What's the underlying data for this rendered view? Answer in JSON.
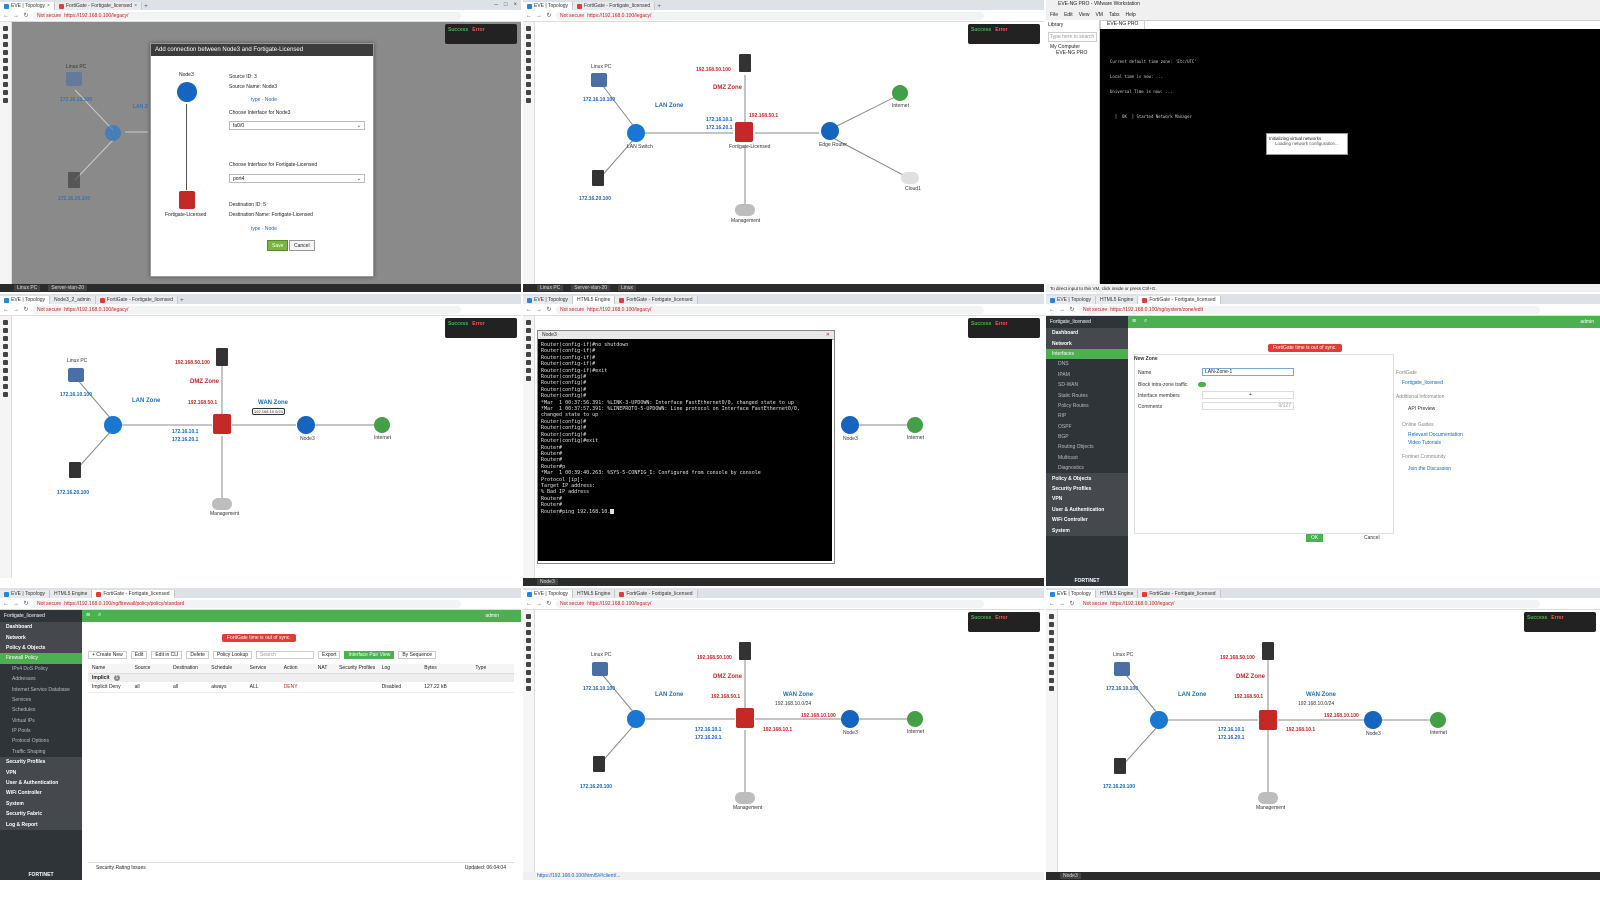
{
  "panels": {
    "p1": {
      "tabs": [
        "EVE | Topology",
        "FortiGate - Fortigate_licensed"
      ],
      "url": "https://192.168.0.100/legacy/",
      "not_secure": "Not secure",
      "status": {
        "success": "Success",
        "error": "Error"
      },
      "dialog": {
        "title": "Add connection between Node3 and Fortigate-Licensed",
        "source_node": "Node3",
        "dest_node": "Fortigate-Licensed",
        "source_id": "Source ID: 3",
        "source_name": "Source Name: Node3",
        "source_type": "type - Node",
        "choose_src": "Choose Interface for Node3",
        "src_value": "fa0/0",
        "choose_dst": "Choose Interface for Fortigate-Licensed",
        "dst_value": "port4",
        "dest_id": "Destination ID: 5",
        "dest_name": "Destination Name: Fortigate-Licensed",
        "dest_type": "type - Node",
        "save": "Save",
        "cancel": "Cancel"
      },
      "labels": {
        "linux": "Linux PC",
        "linux_ip": "172.16.10.100",
        "lan": "LAN Z",
        "server_ip": "172.16.20.100"
      },
      "bottom": [
        "Linux PC",
        "Server-vlan-20"
      ]
    },
    "p2": {
      "tabs": [
        "EVE | Topology",
        "FortiGate - Fortigate_licensed"
      ],
      "url": "https://192.168.0.100/legacy/",
      "not_secure": "Not secure",
      "status": {
        "success": "Success",
        "error": "Error"
      },
      "labels": {
        "linux": "Linux PC",
        "linux_ip": "172.16.10.100",
        "dmz_ip": "192.168.50.100",
        "dmz": "DMZ Zone",
        "dmz_gw": "192.168.50.1",
        "lan": "LAN Zone",
        "fg_ip1": "172.16.10.1",
        "fg_ip2": "172.16.20.1",
        "internet": "Internet",
        "cloud": "Cloud1",
        "edge": "Edge Router",
        "server_ip": "172.16.20.100",
        "mgmt": "Management",
        "lan_switch": "LAN Switch",
        "fortigate": "Fortigate-Licensed"
      },
      "bottom": [
        "Linux PC",
        "Server-vlan-20",
        "Linux"
      ]
    },
    "p3": {
      "title": "EVE-NG PRO - VMware Workstation",
      "menu": [
        "File",
        "Edit",
        "View",
        "VM",
        "Tabs",
        "Help"
      ],
      "library": "Library",
      "search": "Type here to search",
      "tree": [
        "My Computer",
        "EVE-NG PRO"
      ],
      "vm_tab": "EVE-NG PRO",
      "console": [
        "Current default time zone: 'Etc/UTC'",
        "Local time is now: ...",
        "Universal Time is now: ...",
        "",
        "  [  OK  ] Started Network Manager"
      ],
      "dialog_title": "Initializing virtual networks",
      "dialog_text": "Loading network configuration...",
      "statusbar": "To direct input to this VM, click inside or press Ctrl+G."
    },
    "p4": {
      "tabs": [
        "EVE | Topology",
        "Node3_2_admin",
        "FortiGate - Fortigate_licensed"
      ],
      "url": "https://192.168.0.100/legacy/",
      "not_secure": "Not secure",
      "status": {
        "success": "Success",
        "error": "Error"
      },
      "labels": {
        "linux": "Linux PC",
        "linux_ip": "172.16.10.100",
        "dmz_ip": "192.168.50.100",
        "dmz": "DMZ Zone",
        "dmz_gw": "192.168.50.1",
        "lan": "LAN Zone",
        "wan": "WAN Zone",
        "wan_ip": "192.168.10.0/24",
        "fg_ip1": "172.16.10.1",
        "fg_ip2": "172.16.20.1",
        "server_ip": "172.16.20.100",
        "mgmt": "Management",
        "node3": "Node3",
        "internet": "Internet"
      }
    },
    "p5": {
      "tabs": [
        "EVE | Topology",
        "HTML5 Engine",
        "FortiGate - Fortigate_licensed"
      ],
      "url": "https://192.168.0.100/legacy/",
      "not_secure": "Not secure",
      "status": {
        "success": "Success",
        "error": "Error"
      },
      "terminal_title": "Node3",
      "terminal": [
        "Router(config-if)#no shutdown",
        "Router(config-if)#",
        "Router(config-if)#",
        "Router(config-if)#",
        "Router(config-if)#exit",
        "Router(config)#",
        "Router(config)#",
        "Router(config)#",
        "Router(config)#",
        "*Mar  1 00:37:56.391: %LINK-3-UPDOWN: Interface FastEthernet0/0, changed state to up",
        "*Mar  1 00:37:57.391: %LINEPROTO-5-UPDOWN: Line protocol on Interface FastEthernet0/0,",
        "changed state to up",
        "Router(config)#",
        "Router(config)#",
        "Router(config)#",
        "Router(config)#exit",
        "Router#",
        "Router#",
        "Router#",
        "Router#p",
        "*Mar  1 00:39:40.263: %SYS-5-CONFIG_I: Configured from console by console",
        "Protocol [ip]:",
        "Target IP address:",
        "% Bad IP address",
        "Router#",
        "Router#",
        "Router#ping 192.168.10."
      ],
      "node3": "Node3",
      "internet": "Internet",
      "bottom": [
        "Node3"
      ]
    },
    "p6": {
      "tabs": [
        "EVE | Topology",
        "HTML5 Engine",
        "FortiGate - Fortigate_licensed"
      ],
      "url": "https://192.168.0.100/ng/system/zone/edit",
      "not_secure": "Not secure",
      "device": "Fortigate_licensed",
      "alert": "FortiGate time is out of sync.",
      "user": "admin",
      "menu": [
        {
          "label": "Dashboard",
          "kind": "head"
        },
        {
          "label": "Network",
          "kind": "head"
        },
        {
          "label": "Interfaces",
          "kind": "act"
        },
        {
          "label": "DNS",
          "kind": "sub"
        },
        {
          "label": "IPAM",
          "kind": "sub"
        },
        {
          "label": "SD-WAN",
          "kind": "sub"
        },
        {
          "label": "Static Routes",
          "kind": "sub"
        },
        {
          "label": "Policy Routes",
          "kind": "sub"
        },
        {
          "label": "RIP",
          "kind": "sub"
        },
        {
          "label": "OSPF",
          "kind": "sub"
        },
        {
          "label": "BGP",
          "kind": "sub"
        },
        {
          "label": "Routing Objects",
          "kind": "sub"
        },
        {
          "label": "Multicast",
          "kind": "sub"
        },
        {
          "label": "Diagnostics",
          "kind": "sub"
        },
        {
          "label": "Policy & Objects",
          "kind": "head"
        },
        {
          "label": "Security Profiles",
          "kind": "head"
        },
        {
          "label": "VPN",
          "kind": "head"
        },
        {
          "label": "User & Authentication",
          "kind": "head"
        },
        {
          "label": "WiFi Controller",
          "kind": "head"
        },
        {
          "label": "System",
          "kind": "head"
        }
      ],
      "form_title": "New Zone",
      "name_label": "Name",
      "name_value": "LAN-Zone-1",
      "block_label": "Block intra-zone traffic",
      "members_label": "Interface members",
      "comments_label": "Comments",
      "comments_count": "0/127",
      "side_title": "FortiGate",
      "side_device": "Fortigate_licensed",
      "side_info": "Additional Information",
      "side_api": "API Preview",
      "side_online": "Online Guides",
      "side_doc": "Relevant Documentation",
      "side_video": "Video Tutorials",
      "side_community": "Fortinet Community",
      "side_join": "Join the Discussion",
      "ok": "OK",
      "cancel": "Cancel",
      "brand": "FORTINET"
    },
    "p7": {
      "tabs": [
        "EVE | Topology",
        "HTML5 Engine",
        "FortiGate - Fortigate_licensed"
      ],
      "url": "https://192.168.0.100/ng/firewall/policy/policy/standard",
      "not_secure": "Not secure",
      "device": "Fortigate_licensed",
      "alert": "FortiGate time is out of sync.",
      "user": "admin",
      "menu": [
        {
          "label": "Dashboard",
          "kind": "head"
        },
        {
          "label": "Network",
          "kind": "head"
        },
        {
          "label": "Policy & Objects",
          "kind": "head"
        },
        {
          "label": "Firewall Policy",
          "kind": "act"
        },
        {
          "label": "IPv4 DoS Policy",
          "kind": "sub"
        },
        {
          "label": "Addresses",
          "kind": "sub"
        },
        {
          "label": "Internet Service Database",
          "kind": "sub"
        },
        {
          "label": "Services",
          "kind": "sub"
        },
        {
          "label": "Schedules",
          "kind": "sub"
        },
        {
          "label": "Virtual IPs",
          "kind": "sub"
        },
        {
          "label": "IP Pools",
          "kind": "sub"
        },
        {
          "label": "Protocol Options",
          "kind": "sub"
        },
        {
          "label": "Traffic Shaping",
          "kind": "sub"
        },
        {
          "label": "Security Profiles",
          "kind": "head"
        },
        {
          "label": "VPN",
          "kind": "head"
        },
        {
          "label": "User & Authentication",
          "kind": "head"
        },
        {
          "label": "WiFi Controller",
          "kind": "head"
        },
        {
          "label": "System",
          "kind": "head"
        },
        {
          "label": "Security Fabric",
          "kind": "head"
        },
        {
          "label": "Log & Report",
          "kind": "head"
        }
      ],
      "toolbar": [
        "+ Create New",
        "Edit",
        "Edit in CLI",
        "Delete",
        "Policy Lookup",
        "Search",
        "Export",
        "Interface Pair View",
        "By Sequence"
      ],
      "columns": [
        "Name",
        "Source",
        "Destination",
        "Schedule",
        "Service",
        "Action",
        "NAT",
        "Security Profiles",
        "Log",
        "Bytes",
        "Type"
      ],
      "group": "Implicit",
      "group_count": "1",
      "row": [
        "Implicit Deny",
        "all",
        "all",
        "always",
        "ALL",
        "DENY",
        "",
        "",
        "Disabled",
        "127.22 kB",
        ""
      ],
      "footer_left": "Security Rating Issues",
      "footer_right": "Updated: 06:04:04",
      "brand": "FORTINET"
    },
    "p8": {
      "tabs": [
        "EVE | Topology",
        "HTML5 Engine",
        "FortiGate - Fortigate_licensed"
      ],
      "url": "https://192.168.0.100/legacy/",
      "not_secure": "Not secure",
      "status": {
        "success": "Success",
        "error": "Error"
      },
      "labels": {
        "linux": "Linux PC",
        "linux_ip": "172.16.10.100",
        "dmz_ip": "192.168.50.100",
        "dmz": "DMZ Zone",
        "dmz_gw": "192.168.50.1",
        "lan": "LAN Zone",
        "wan": "WAN Zone",
        "wan_net": "192.168.10.0/24",
        "wan_fg": "192.168.10.1",
        "wan_r": "192.168.10.100",
        "fg_ip1": "172.16.10.1",
        "fg_ip2": "172.16.20.1",
        "server_ip": "172.16.20.100",
        "mgmt": "Management",
        "node3": "Node3",
        "internet": "Internet"
      },
      "statusbar": "https://192.168.0.100/html5/#/client/..."
    },
    "p9": {
      "tabs": [
        "EVE | Topology",
        "HTML5 Engine",
        "FortiGate - Fortigate_licensed"
      ],
      "url": "https://192.168.0.100/legacy/",
      "not_secure": "Not secure",
      "status": {
        "success": "Success",
        "error": "Error"
      },
      "labels": {
        "linux": "Linux PC",
        "linux_ip": "172.16.10.100",
        "dmz_ip": "192.168.50.100",
        "dmz": "DMZ Zone",
        "dmz_gw": "192.168.50.1",
        "lan": "LAN Zone",
        "wan": "WAN Zone",
        "wan_net": "192.168.10.0/24",
        "wan_fg": "192.168.10.1",
        "wan_r": "192.168.10.100",
        "fg_ip1": "172.16.10.1",
        "fg_ip2": "172.16.20.1",
        "server_ip": "172.16.20.100",
        "mgmt": "Management",
        "node3": "Node3",
        "internet": "Internet"
      },
      "bottom": [
        "Node3"
      ]
    }
  },
  "colors": {
    "accent_green": "#4caf50",
    "error_red": "#e53935",
    "zone_blue": "#1e6fb8",
    "zone_red": "#c62828"
  }
}
